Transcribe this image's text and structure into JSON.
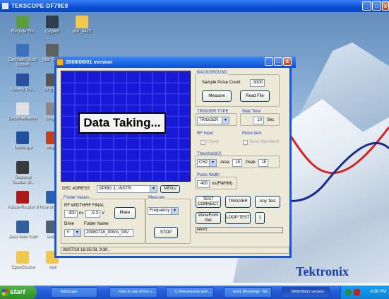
{
  "outer_window": {
    "title": "TEKSCOPE-DF79E9"
  },
  "desktop_icons": [
    {
      "label": "Recycle Bin",
      "icon": "recycle-bin-icon",
      "color": "#5b9e3e"
    },
    {
      "label": "Cygwin",
      "icon": "cygwin-icon",
      "color": "#2e3e4e"
    },
    {
      "label": "test_0422",
      "icon": "folder-icon",
      "color": "#f2c84c"
    },
    {
      "label": "Calibrate Touch Screen",
      "icon": "calibrate-icon",
      "color": "#3a70c0"
    },
    {
      "label": "Star Serve",
      "icon": "star-serve-icon",
      "color": "#606060"
    },
    {
      "label": "Acronis Tru...",
      "icon": "acronis-icon",
      "color": "#2a4ea0"
    },
    {
      "label": "Sing (Dis",
      "icon": "sing-icon",
      "color": "#555555"
    },
    {
      "label": "Documentation",
      "icon": "documentation-icon",
      "color": "#e0e0e0"
    },
    {
      "label": "Singule",
      "icon": "singule-icon",
      "color": "#888888"
    },
    {
      "label": "TekScope",
      "icon": "tekscope-icon",
      "color": "#2050a0"
    },
    {
      "label": "Mozilla",
      "icon": "mozilla-icon",
      "color": "#c04020"
    },
    {
      "label": "Tektronix Toolbar St...",
      "icon": "toolbar-icon",
      "color": "#3a3a3a"
    },
    {
      "label": "Adobe Reader 8",
      "icon": "adobe-reader-icon",
      "color": "#b01818"
    },
    {
      "label": "How to the co",
      "icon": "howto-icon",
      "color": "#2a60b0"
    },
    {
      "label": "Java Web Start",
      "icon": "java-icon",
      "color": "#3060a0"
    },
    {
      "label": "teldpp",
      "icon": "teldpp-icon",
      "color": "#506070"
    },
    {
      "label": "OpenChoice",
      "icon": "folder-icon",
      "color": "#f2c84c"
    },
    {
      "label": "test",
      "icon": "folder-icon",
      "color": "#f2c84c"
    }
  ],
  "app": {
    "title": "2008/06/01 version",
    "scope_message": "Data Taking...",
    "background_group": "BACKGROUND",
    "sample_pulse_label": "Sample Pulse Count",
    "sample_pulse_value": "3000",
    "measure_btn": "Measure",
    "readfile_btn": "Read File",
    "trigger_type_label": "TRIGGER TYPE",
    "trigger_type_value": "TRIGGER",
    "wait_time_label": "Wait Time",
    "wait_time_value": "10",
    "wait_time_unit": "Sec",
    "rf_input_label": "RF Input",
    "check_label": "Check",
    "pulse_lack_label": "Pulse lack",
    "save_waveform_label": "Save Waveform",
    "threshold_label": "Threshold(V)",
    "threshold_channel": "CH2",
    "area_label": "Area",
    "area_value": "15",
    "peak_label": "Peak",
    "peak_value": "15",
    "pulse_width_label": "Pulse Width",
    "pulse_width_value": "400",
    "pulse_width_unit": "ns(FWHM)",
    "test_connect_btn": "TEST CONNECT",
    "trigger_btn": "TRIGGER",
    "any_test_btn": "Any Test",
    "waveform_get_btn": "WaveForm Get",
    "loop_test_btn": "LOOP TEST",
    "one_btn": "1",
    "label_box": "label1",
    "osc_adress_label": "OSC ADRESS",
    "osc_adress_value": "GPIB0::1::INSTR",
    "menu_btn": "MENU",
    "folder_values_label": "Folder Values",
    "rf_width_label": "RF WIDTH",
    "rf_final_label": "RF FINAL",
    "rf_width_value": "300",
    "rf_width_unit": "ns",
    "rf_final_value": "-9.3",
    "rf_final_unit": "V",
    "make_btn": "Make",
    "drive_label": "Drive",
    "folder_name_label": "Folder Name",
    "drive_value": "Y:",
    "folder_name_value": "20080718_300ns_93V",
    "measure_group_label": "Measure",
    "measure_select": "Frequency",
    "stop_btn": "STOP",
    "status_text": "08/07/19 16:35:03, 9:30,"
  },
  "taskbar": {
    "start": "start",
    "tasks": [
      {
        "label": "TekScope"
      },
      {
        "label": "How to use of the c..."
      },
      {
        "label": "C:\\Documents and ..."
      },
      {
        "label": "test1 (Running) - Mi..."
      },
      {
        "label": "2008/06/01 version"
      }
    ],
    "time": "4:36 PM"
  },
  "brand": "Tektronix"
}
